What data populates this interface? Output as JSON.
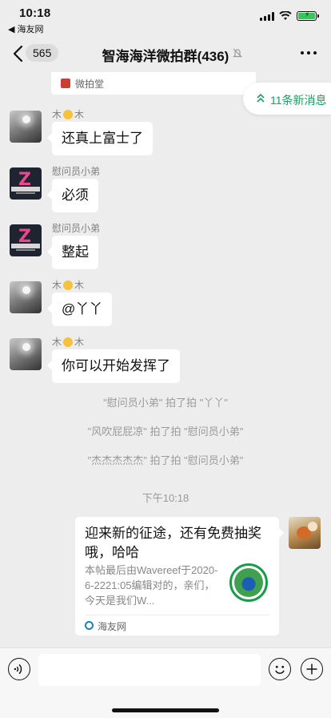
{
  "status": {
    "time": "10:18",
    "back_app": "◀ 海友网"
  },
  "nav": {
    "unread_count": "565",
    "title": "智海海洋微拍群(436)"
  },
  "quote": {
    "text": "微拍堂"
  },
  "new_messages": {
    "label": "11条新消息"
  },
  "messages": [
    {
      "sender_a": "木",
      "sender_b": "木",
      "text": "还真上富士了"
    },
    {
      "sender": "慰问员小弟",
      "text": "必须"
    },
    {
      "sender": "慰问员小弟",
      "text": "整起"
    },
    {
      "sender_a": "木",
      "sender_b": "木",
      "text": "@丫丫"
    },
    {
      "sender_a": "木",
      "sender_b": "木",
      "text": "你可以开始发挥了"
    }
  ],
  "avatar_text": "智海海洋",
  "system_notes": [
    "\"慰问员小弟\" 拍了拍 \"丫丫\"",
    "\"风吹屁屁凉\" 拍了拍 \"慰问员小弟\"",
    "\"杰杰杰杰杰\" 拍了拍 \"慰问员小弟\""
  ],
  "time_divider": "下午10:18",
  "link_card": {
    "title": "迎来新的征途，还有免费抽奖哦，哈哈",
    "description": "本帖最后由Wavereef于2020-6-2221:05编辑对的，亲们，今天是我们W...",
    "source": "海友网"
  }
}
